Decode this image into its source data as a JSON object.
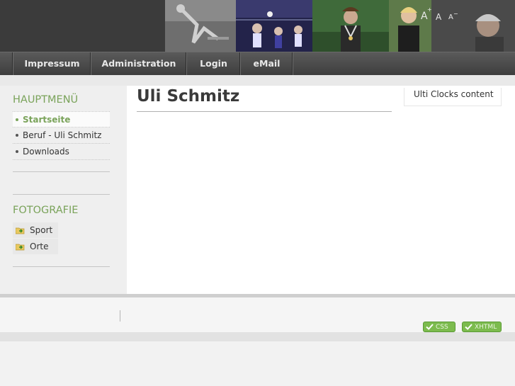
{
  "header": {
    "font_controls": {
      "increase": "A",
      "increase_sup": "+",
      "normal": "A",
      "decrease": "A",
      "decrease_sup": "−"
    },
    "banner_photos": [
      "sports-photo-skateboard",
      "sports-photo-volleyball",
      "sports-photo-runner",
      "sports-photo-athlete",
      "sports-photo-portrait"
    ]
  },
  "nav": {
    "items": [
      {
        "label": "Impressum"
      },
      {
        "label": "Administration"
      },
      {
        "label": "Login"
      },
      {
        "label": "eMail"
      }
    ]
  },
  "sidebar": {
    "main_menu": {
      "title": "HAUPTMENÜ",
      "items": [
        {
          "label": "Startseite",
          "active": true
        },
        {
          "label": "Beruf - Uli Schmitz",
          "active": false
        },
        {
          "label": "Downloads",
          "active": false
        }
      ]
    },
    "photo_menu": {
      "title": "FOTOGRAFIE",
      "items": [
        {
          "label": "Sport",
          "icon": "folder-arrow-icon"
        },
        {
          "label": "Orte",
          "icon": "folder-arrow-icon"
        }
      ]
    }
  },
  "main": {
    "title": "Uli Schmitz",
    "clock_module": "Ulti Clocks content"
  },
  "footer": {
    "badges": [
      {
        "label": "CSS",
        "icon": "check-icon"
      },
      {
        "label": "XHTML",
        "icon": "check-icon"
      }
    ]
  },
  "colors": {
    "accent": "#7aa35a",
    "header_bg": "#3b3b3b",
    "nav_bg": "#4a4a4a",
    "badge_green": "#7cbb4e"
  }
}
